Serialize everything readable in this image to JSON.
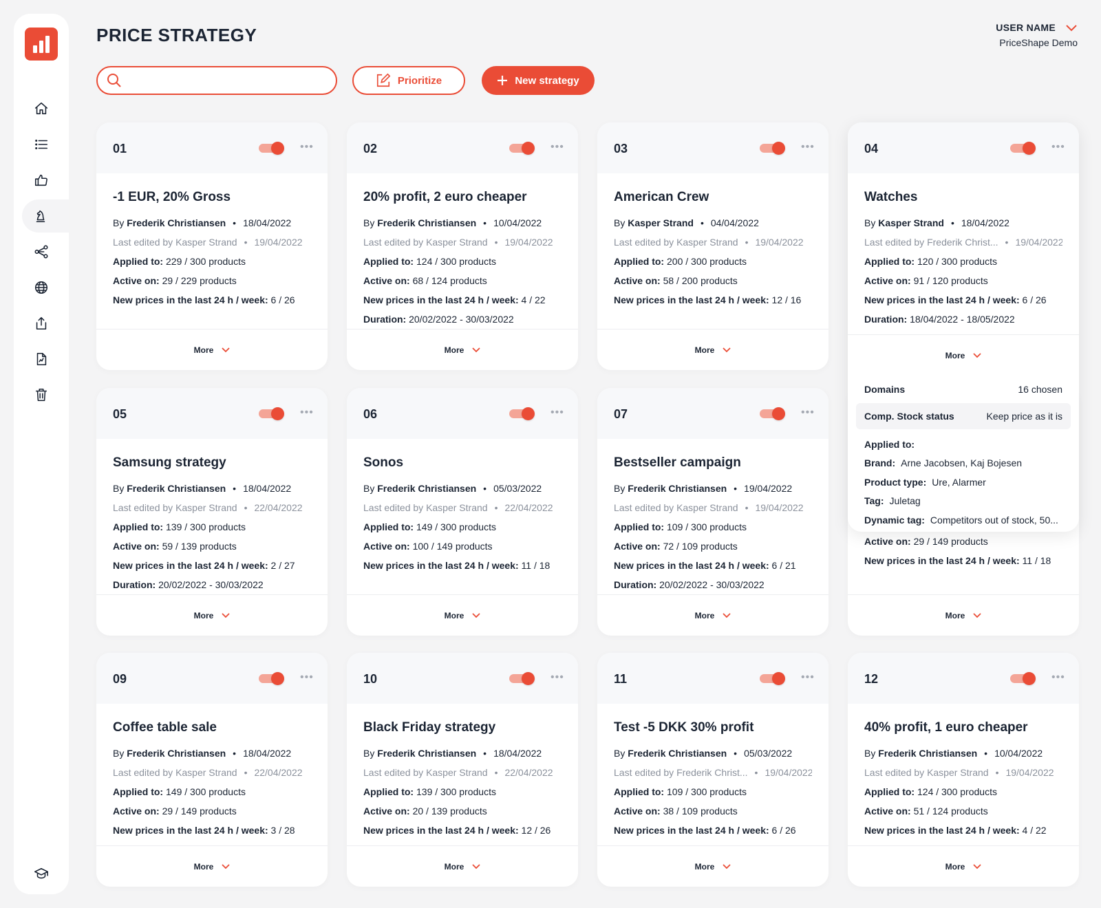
{
  "page": {
    "title": "PRICE STRATEGY"
  },
  "user": {
    "name": "USER NAME",
    "org": "PriceShape Demo"
  },
  "toolbar": {
    "search_placeholder": "",
    "prioritize_label": "Prioritize",
    "new_label": "New strategy"
  },
  "sidebar": {
    "items": [
      {
        "icon": "home-icon"
      },
      {
        "icon": "list-icon"
      },
      {
        "icon": "thumbs-up-icon"
      },
      {
        "icon": "chess-knight-icon",
        "active": true
      },
      {
        "icon": "share-nodes-icon"
      },
      {
        "icon": "globe-icon"
      },
      {
        "icon": "upload-icon"
      },
      {
        "icon": "report-icon"
      },
      {
        "icon": "trash-icon"
      },
      {
        "icon": "graduation-cap-icon"
      }
    ]
  },
  "labels": {
    "by": "By",
    "last_edited": "Last edited by",
    "applied": "Applied to:",
    "active": "Active on:",
    "new_prices": "New prices in the last 24 h / week:",
    "duration": "Duration:",
    "more": "More",
    "products": "products"
  },
  "cards": [
    {
      "num": "01",
      "title": "-1 EUR, 20% Gross",
      "author": "Frederik Christiansen",
      "date": "18/04/2022",
      "editor": "Kasper Strand",
      "edit_date": "19/04/2022",
      "applied": "229 / 300 products",
      "active": "29 / 229 products",
      "new_prices": "6 / 26",
      "duration": ""
    },
    {
      "num": "02",
      "title": "20% profit, 2 euro cheaper",
      "author": "Frederik Christiansen",
      "date": "10/04/2022",
      "editor": "Kasper Strand",
      "edit_date": "19/04/2022",
      "applied": "124 / 300 products",
      "active": "68 / 124 products",
      "new_prices": "4 / 22",
      "duration": "20/02/2022 - 30/03/2022"
    },
    {
      "num": "03",
      "title": "American Crew",
      "author": "Kasper Strand",
      "date": "04/04/2022",
      "editor": "Kasper Strand",
      "edit_date": "19/04/2022",
      "applied": "200 / 300 products",
      "active": "58 / 200 products",
      "new_prices": "12 / 16",
      "duration": ""
    },
    {
      "num": "05",
      "title": "Samsung strategy",
      "author": "Frederik Christiansen",
      "date": "18/04/2022",
      "editor": "Kasper Strand",
      "edit_date": "22/04/2022",
      "applied": "139 / 300 products",
      "active": "59 / 139 products",
      "new_prices": "2 / 27",
      "duration": "20/02/2022 - 30/03/2022"
    },
    {
      "num": "06",
      "title": "Sonos",
      "author": "Frederik Christiansen",
      "date": "05/03/2022",
      "editor": "Kasper Strand",
      "edit_date": "22/04/2022",
      "applied": "149 / 300 products",
      "active": "100 / 149 products",
      "new_prices": "11 / 18",
      "duration": ""
    },
    {
      "num": "07",
      "title": "Bestseller campaign",
      "author": "Frederik Christiansen",
      "date": "19/04/2022",
      "editor": "Kasper Strand",
      "edit_date": "19/04/2022",
      "applied": "109 / 300 products",
      "active": "72 / 109 products",
      "new_prices": "6 / 21",
      "duration": "20/02/2022 - 30/03/2022"
    },
    {
      "num": "09",
      "title": "Coffee table sale",
      "author": "Frederik Christiansen",
      "date": "18/04/2022",
      "editor": "Kasper Strand",
      "edit_date": "22/04/2022",
      "applied": "149 / 300 products",
      "active": "29 / 149 products",
      "new_prices": "3 / 28",
      "duration": ""
    },
    {
      "num": "10",
      "title": "Black Friday strategy",
      "author": "Frederik Christiansen",
      "date": "18/04/2022",
      "editor": "Kasper Strand",
      "edit_date": "22/04/2022",
      "applied": "139 / 300 products",
      "active": "20 / 139 products",
      "new_prices": "12 / 26",
      "duration": ""
    },
    {
      "num": "11",
      "title": "Test -5 DKK 30% profit",
      "author": "Frederik Christiansen",
      "date": "05/03/2022",
      "editor": "Frederik Christ...",
      "edit_date": "19/04/2022",
      "applied": "109 / 300 products",
      "active": "38 / 109 products",
      "new_prices": "6 / 26",
      "duration": ""
    },
    {
      "num": "12",
      "title": "40% profit, 1 euro cheaper",
      "author": "Frederik Christiansen",
      "date": "10/04/2022",
      "editor": "Kasper Strand",
      "edit_date": "19/04/2022",
      "applied": "124 / 300 products",
      "active": "51 / 124 products",
      "new_prices": "4 / 22",
      "duration": ""
    }
  ],
  "card08_partial": {
    "active": "29 / 149 products",
    "new_prices": "11 / 18"
  },
  "expanded": {
    "num": "04",
    "title": "Watches",
    "author": "Kasper Strand",
    "date": "18/04/2022",
    "editor": "Frederik Christ...",
    "edit_date": "19/04/2022",
    "applied": "120 / 300 products",
    "active": "91 / 120 products",
    "new_prices": "6 / 26",
    "duration": "18/04/2022 - 18/05/2022",
    "domains_label": "Domains",
    "domains_value": "16 chosen",
    "stock_label": "Comp. Stock status",
    "stock_value": "Keep price as it is",
    "applied_head": "Applied to:",
    "brand_label": "Brand:",
    "brand_value": "Arne Jacobsen, Kaj Bojesen",
    "ptype_label": "Product type:",
    "ptype_value": "Ure, Alarmer",
    "tag_label": "Tag:",
    "tag_value": "Juletag",
    "dyn_label": "Dynamic tag:",
    "dyn_value": "Competitors out of stock, 50..."
  },
  "colors": {
    "accent": "#ea4c36",
    "accent_light": "#f4a597",
    "text": "#1b2433",
    "muted": "#8b919c"
  }
}
